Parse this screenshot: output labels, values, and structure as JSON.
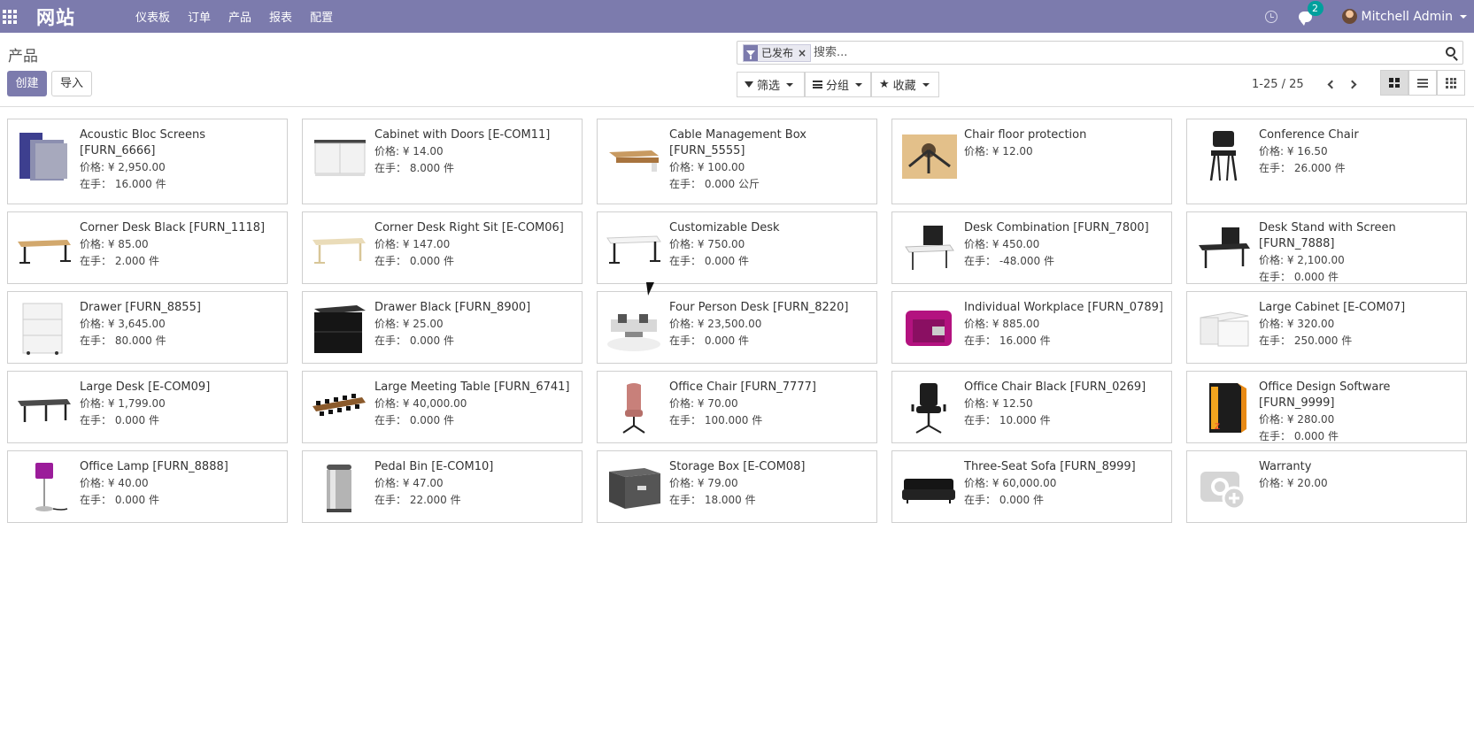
{
  "navbar": {
    "brand": "网站",
    "menu": [
      {
        "label": "仪表板"
      },
      {
        "label": "订单"
      },
      {
        "label": "产品"
      },
      {
        "label": "报表"
      },
      {
        "label": "配置"
      }
    ],
    "chat_badge": "2",
    "user_name": "Mitchell Admin",
    "accent_color": "#7c7bad"
  },
  "control": {
    "title": "产品",
    "create_label": "创建",
    "import_label": "导入",
    "search": {
      "facet_label": "已发布",
      "facet_remove": "×",
      "placeholder": "搜索..."
    },
    "filter_label": "筛选",
    "group_label": "分组",
    "favorites_label": "收藏",
    "pager": "1-25 / 25",
    "views": [
      "kanban",
      "list",
      "grid"
    ],
    "active_view": "kanban"
  },
  "products": [
    {
      "name": "Acoustic Bloc Screens",
      "ref": "[FURN_6666]",
      "price": "价格: ¥ 2,950.00",
      "onhand": "在手：  16.000 件",
      "icon": "acoustic-screens"
    },
    {
      "name": "Cabinet with Doors",
      "ref": "[E-COM11]",
      "price": "价格: ¥ 14.00",
      "onhand": "在手：  8.000 件",
      "icon": "cabinet"
    },
    {
      "name": "Cable Management Box",
      "ref": "[FURN_5555]",
      "price": "价格: ¥ 100.00",
      "onhand": "在手：  0.000 公斤",
      "icon": "cable-box"
    },
    {
      "name": "Chair floor protection",
      "ref": "",
      "price": "价格: ¥ 12.00",
      "onhand": "",
      "icon": "floor-mat"
    },
    {
      "name": "Conference Chair",
      "ref": "",
      "price": "价格: ¥ 16.50",
      "onhand": "在手：  26.000 件",
      "icon": "chair-black"
    },
    {
      "name": "Corner Desk Black",
      "ref": "[FURN_1118]",
      "price": "价格: ¥ 85.00",
      "onhand": "在手：  2.000 件",
      "icon": "desk-wood"
    },
    {
      "name": "Corner Desk Right Sit",
      "ref": "[E-COM06]",
      "price": "价格: ¥ 147.00",
      "onhand": "在手：  0.000 件",
      "icon": "desk-light"
    },
    {
      "name": "Customizable Desk",
      "ref": "",
      "price": "价格: ¥ 750.00",
      "onhand": "在手：  0.000 件",
      "icon": "desk-white"
    },
    {
      "name": "Desk Combination",
      "ref": "[FURN_7800]",
      "price": "价格: ¥ 450.00",
      "onhand": "在手：  -48.000 件",
      "icon": "desk-combo"
    },
    {
      "name": "Desk Stand with Screen",
      "ref": "[FURN_7888]",
      "price": "价格: ¥ 2,100.00",
      "onhand": "在手：  0.000 件",
      "icon": "desk-screen"
    },
    {
      "name": "Drawer",
      "ref": "[FURN_8855]",
      "price": "价格: ¥ 3,645.00",
      "onhand": "在手：  80.000 件",
      "icon": "drawer-white"
    },
    {
      "name": "Drawer Black",
      "ref": "[FURN_8900]",
      "price": "价格: ¥ 25.00",
      "onhand": "在手：  0.000 件",
      "icon": "drawer-black"
    },
    {
      "name": "Four Person Desk",
      "ref": "[FURN_8220]",
      "price": "价格: ¥ 23,500.00",
      "onhand": "在手：  0.000 件",
      "icon": "four-desk"
    },
    {
      "name": "Individual Workplace",
      "ref": "[FURN_0789]",
      "price": "价格: ¥ 885.00",
      "onhand": "在手：  16.000 件",
      "icon": "workplace-magenta"
    },
    {
      "name": "Large Cabinet",
      "ref": "[E-COM07]",
      "price": "价格: ¥ 320.00",
      "onhand": "在手：  250.000 件",
      "icon": "large-cabinet"
    },
    {
      "name": "Large Desk",
      "ref": "[E-COM09]",
      "price": "价格: ¥ 1,799.00",
      "onhand": "在手：  0.000 件",
      "icon": "large-desk"
    },
    {
      "name": "Large Meeting Table",
      "ref": "[FURN_6741]",
      "price": "价格: ¥ 40,000.00",
      "onhand": "在手：  0.000 件",
      "icon": "meeting-table"
    },
    {
      "name": "Office Chair",
      "ref": "[FURN_7777]",
      "price": "价格: ¥ 70.00",
      "onhand": "在手：  100.000 件",
      "icon": "chair-pink"
    },
    {
      "name": "Office Chair Black",
      "ref": "[FURN_0269]",
      "price": "价格: ¥ 12.50",
      "onhand": "在手：  10.000 件",
      "icon": "chair-office-black"
    },
    {
      "name": "Office Design Software",
      "ref": "[FURN_9999]",
      "price": "价格: ¥ 280.00",
      "onhand": "在手：  0.000 件",
      "icon": "software-box"
    },
    {
      "name": "Office Lamp",
      "ref": "[FURN_8888]",
      "price": "价格: ¥ 40.00",
      "onhand": "在手：  0.000 件",
      "icon": "lamp-purple"
    },
    {
      "name": "Pedal Bin",
      "ref": "[E-COM10]",
      "price": "价格: ¥ 47.00",
      "onhand": "在手：  22.000 件",
      "icon": "pedal-bin"
    },
    {
      "name": "Storage Box",
      "ref": "[E-COM08]",
      "price": "价格: ¥ 79.00",
      "onhand": "在手：  18.000 件",
      "icon": "storage-box"
    },
    {
      "name": "Three-Seat Sofa",
      "ref": "[FURN_8999]",
      "price": "价格: ¥ 60,000.00",
      "onhand": "在手：  0.000 件",
      "icon": "sofa-black"
    },
    {
      "name": "Warranty",
      "ref": "",
      "price": "价格: ¥ 20.00",
      "onhand": "",
      "icon": "placeholder-camera"
    }
  ]
}
